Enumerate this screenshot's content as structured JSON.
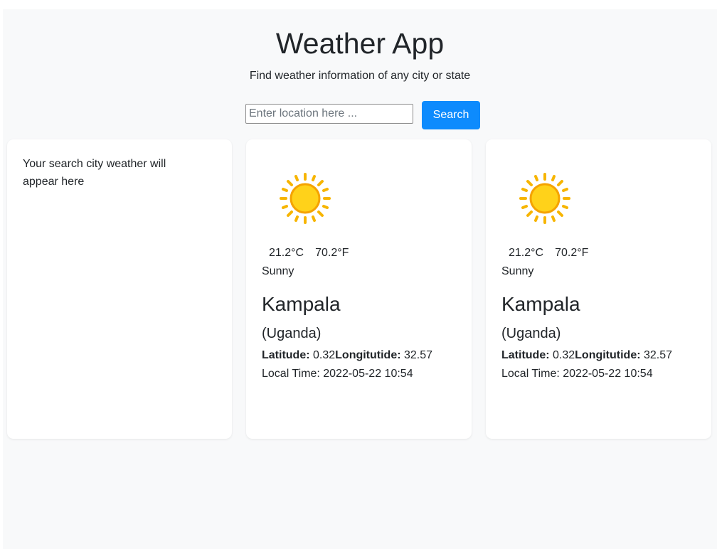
{
  "header": {
    "title": "Weather App",
    "subtitle": "Find weather information of any city or state"
  },
  "search": {
    "placeholder": "Enter location here ...",
    "value": "",
    "button_label": "Search",
    "button_color": "#0d8bfd"
  },
  "placeholder_card": {
    "text": "Your search city weather will appear here"
  },
  "results": [
    {
      "icon": "sun-icon",
      "temp_c": "21.2°C",
      "temp_f": "70.2°F",
      "condition": "Sunny",
      "city": "Kampala",
      "country": "(Uganda)",
      "latitude_label": "Latitude:",
      "latitude_value": " 0.32",
      "longitude_label": "Longitutide:",
      "longitude_value": " 32.57",
      "local_time": "Local Time: 2022-05-22 10:54"
    },
    {
      "icon": "sun-icon",
      "temp_c": "21.2°C",
      "temp_f": "70.2°F",
      "condition": "Sunny",
      "city": "Kampala",
      "country": "(Uganda)",
      "latitude_label": "Latitude:",
      "latitude_value": " 0.32",
      "longitude_label": "Longitutide:",
      "longitude_value": " 32.57",
      "local_time": "Local Time: 2022-05-22 10:54"
    }
  ]
}
